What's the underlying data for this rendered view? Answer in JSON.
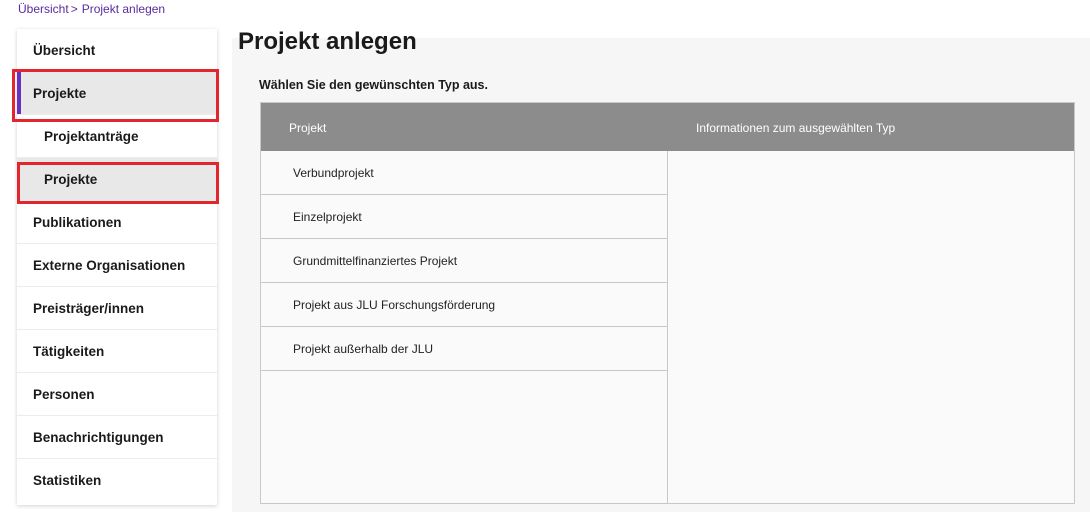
{
  "breadcrumb": {
    "home": "Übersicht",
    "separator": ">",
    "current": "Projekt anlegen"
  },
  "sidebar": {
    "items": [
      {
        "label": "Übersicht"
      },
      {
        "label": "Projekte"
      },
      {
        "label": "Projektanträge"
      },
      {
        "label": "Projekte"
      },
      {
        "label": "Publikationen"
      },
      {
        "label": "Externe Organisationen"
      },
      {
        "label": "Preisträger/innen"
      },
      {
        "label": "Tätigkeiten"
      },
      {
        "label": "Personen"
      },
      {
        "label": "Benachrichtigungen"
      },
      {
        "label": "Statistiken"
      }
    ]
  },
  "main": {
    "title": "Projekt anlegen",
    "instruction": "Wählen Sie den gewünschten Typ aus.",
    "table": {
      "headers": [
        "Projekt",
        "Informationen zum ausgewählten Typ"
      ],
      "types": [
        "Verbundprojekt",
        "Einzelprojekt",
        "Grundmittelfinanziertes Projekt",
        "Projekt aus JLU Forschungsförderung",
        "Projekt außerhalb der JLU"
      ]
    }
  },
  "colors": {
    "accent": "#6a2ec0",
    "link": "#5a2aa0",
    "highlight": "#e3262d",
    "header_bg": "#8c8c8c"
  }
}
